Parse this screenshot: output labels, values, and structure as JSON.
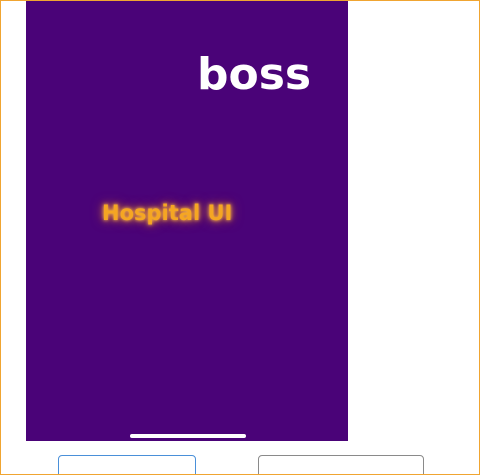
{
  "screen": {
    "header_text": "boss",
    "center_label": "Hospital UI"
  },
  "colors": {
    "screen_background": "#4a0378",
    "header_text": "#ffffff",
    "center_label": "#f5a623",
    "frame_border": "#f0a531",
    "left_button_border": "#4a90d9",
    "right_button_border": "#8a8a8a"
  },
  "buttons": {
    "left_label": "",
    "right_label": ""
  }
}
